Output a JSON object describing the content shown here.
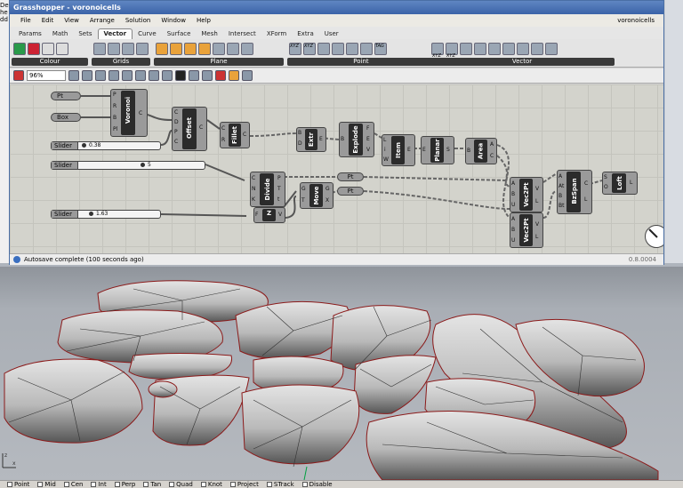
{
  "background": {
    "left_text": [
      "Deve",
      "he",
      "dd"
    ]
  },
  "window": {
    "title": "Grasshopper - voronoicells",
    "document_name": "voronoicells"
  },
  "menu": [
    "File",
    "Edit",
    "View",
    "Arrange",
    "Solution",
    "Window",
    "Help"
  ],
  "tabs": [
    "Params",
    "Math",
    "Sets",
    "Vector",
    "Curve",
    "Surface",
    "Mesh",
    "Intersect",
    "XForm",
    "Extra",
    "User"
  ],
  "active_tab": "Vector",
  "ribbon_groups": [
    "Colour",
    "Grids",
    "Plane",
    "Point",
    "Vector"
  ],
  "ribbon_icon_text": [
    "XYZ",
    "XYZ",
    "XYZ",
    "XYZ",
    "TAG"
  ],
  "zoom_value": "96%",
  "components": {
    "pt_input": "Pt",
    "box_input": "Box",
    "voronoi": {
      "name": "Voronoi",
      "inputs": [
        "P",
        "R",
        "B",
        "Pl"
      ],
      "outputs": [
        "C"
      ]
    },
    "offset": {
      "name": "Offset",
      "inputs": [
        "C",
        "D",
        "P",
        "C"
      ],
      "outputs": [
        "C"
      ]
    },
    "fillet": {
      "name": "Fillet",
      "inputs": [
        "C",
        "R"
      ],
      "outputs": [
        "C"
      ]
    },
    "extr": {
      "name": "Extr",
      "inputs": [
        "B",
        "D"
      ],
      "outputs": [
        "E"
      ]
    },
    "explode": {
      "name": "Explode",
      "inputs": [
        "B"
      ],
      "outputs": [
        "F",
        "E",
        "V"
      ]
    },
    "item": {
      "name": "Item",
      "inputs": [
        "L",
        "i",
        "W"
      ],
      "outputs": [
        "E"
      ]
    },
    "planar": {
      "name": "Planar",
      "inputs": [
        "E"
      ],
      "outputs": [
        "S"
      ]
    },
    "area": {
      "name": "Area",
      "inputs": [
        "B"
      ],
      "outputs": [
        "A",
        "C"
      ]
    },
    "divide": {
      "name": "Divide",
      "inputs": [
        "C",
        "N",
        "K"
      ],
      "outputs": [
        "P",
        "T",
        "t"
      ]
    },
    "z": {
      "name": "Z",
      "inputs": [
        "F"
      ],
      "outputs": [
        "V"
      ]
    },
    "move": {
      "name": "Move",
      "inputs": [
        "G",
        "T"
      ],
      "outputs": [
        "G",
        "X"
      ]
    },
    "pt_mid1": "Pt",
    "pt_mid2": "Pt",
    "vec2pt_a": {
      "name": "Vec2Pt",
      "inputs": [
        "A",
        "B",
        "U"
      ],
      "outputs": [
        "V",
        "L"
      ]
    },
    "vec2pt_b": {
      "name": "Vec2Pt",
      "inputs": [
        "A",
        "B",
        "U"
      ],
      "outputs": [
        "V",
        "L"
      ]
    },
    "bzspan": {
      "name": "BzSpan",
      "inputs": [
        "A",
        "At",
        "B",
        "Bt"
      ],
      "outputs": [
        "C",
        "L"
      ]
    },
    "loft": {
      "name": "Loft",
      "inputs": [
        "S",
        "O"
      ],
      "outputs": [
        "L"
      ]
    }
  },
  "sliders": [
    {
      "name": "Slider",
      "value": "0.38",
      "fraction": 0.38
    },
    {
      "name": "Slider",
      "value": "5",
      "fraction": 0.5
    },
    {
      "name": "Slider",
      "value": "1.63",
      "fraction": 0.16
    }
  ],
  "status_message": "Autosave complete (100 seconds ago)",
  "version": "0.8.0004",
  "rhino_status": [
    "Point",
    "Mid",
    "Cen",
    "Int",
    "Perp",
    "Tan",
    "Quad",
    "Knot",
    "Project",
    "STrack",
    "Disable"
  ],
  "colors": {
    "title_bar": "#3b63a8",
    "canvas": "#d3d3cc",
    "component_body": "#9a9a9a",
    "component_core": "#2b2b2b",
    "viewport_bg": "#a9aeb5",
    "surface_edge": "#8b1a1a"
  }
}
